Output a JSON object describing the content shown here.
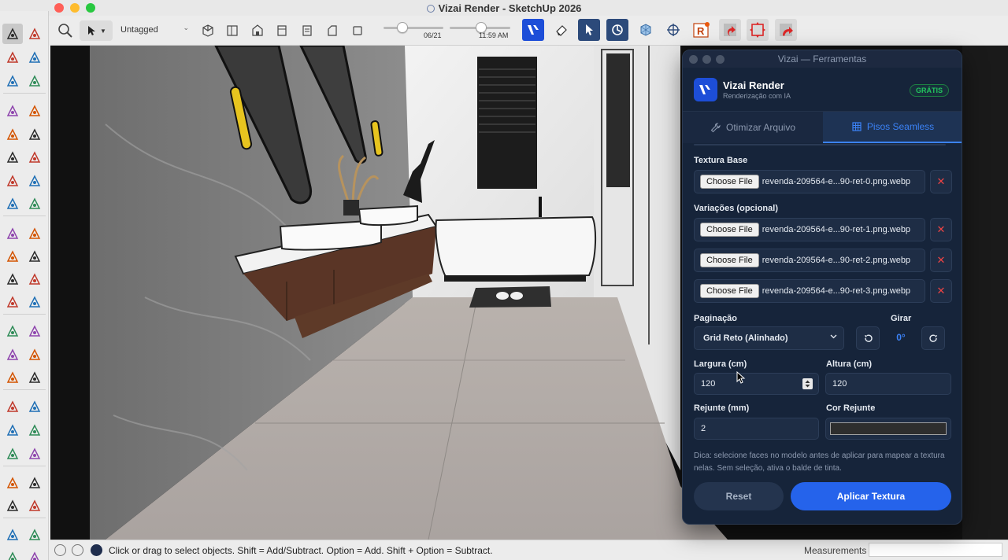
{
  "window": {
    "title": "Vizai Render - SketchUp 2026"
  },
  "toolbar": {
    "tag_value": "Untagged",
    "date_label": "06/21",
    "time_label": "11:59 AM",
    "date_fraction": 0.32,
    "time_fraction": 0.52,
    "icons": [
      "zoom-icon",
      "select-icon",
      "tag-icon",
      "view-iso-icon",
      "view-top-icon",
      "view-front-icon",
      "view-right-icon",
      "view-back-icon",
      "view-left-icon",
      "view-bottom-icon",
      "vizai-logo-icon",
      "eraser-icon",
      "ext-blue-1-icon",
      "ext-blue-2-icon",
      "ext-cube-icon",
      "ext-target-icon",
      "ext-render-icon",
      "ext-red-1-icon",
      "ext-red-2-icon",
      "ext-red-3-icon"
    ]
  },
  "status": {
    "hint": "Click or drag to select objects. Shift = Add/Subtract. Option = Add. Shift + Option = Subtract.",
    "measurements_label": "Measurements"
  },
  "panel": {
    "window_title": "Vizai — Ferramentas",
    "brand": "Vizai Render",
    "brand_sub": "Renderização com IA",
    "badge": "GRÁTIS",
    "tabs": [
      {
        "label": "Otimizar Arquivo",
        "icon": "wrench-icon",
        "active": false
      },
      {
        "label": "Pisos Seamless",
        "icon": "grid-icon",
        "active": true
      }
    ],
    "texture_base_label": "Textura Base",
    "variations_label": "Variações (opcional)",
    "choose_file": "Choose File",
    "files": [
      "revenda-209564-e...90-ret-0.png.webp",
      "revenda-209564-e...90-ret-1.png.webp",
      "revenda-209564-e...90-ret-2.png.webp",
      "revenda-209564-e...90-ret-3.png.webp"
    ],
    "pagination_label": "Paginação",
    "pagination_value": "Grid Reto (Alinhado)",
    "rotate_label": "Girar",
    "rotate_value": "0°",
    "width_label": "Largura (cm)",
    "width_value": "120",
    "height_label": "Altura (cm)",
    "height_value": "120",
    "grout_label": "Rejunte (mm)",
    "grout_value": "2",
    "grout_color_label": "Cor Rejunte",
    "grout_color": "#2e2e2e",
    "tip": "Dica: selecione faces no modelo antes de aplicar para mapear a textura nelas. Sem seleção, ativa o balde de tinta.",
    "reset_label": "Reset",
    "apply_label": "Aplicar Textura"
  },
  "colors": {
    "accent": "#2563eb",
    "accent_text": "#3b82f6",
    "panel_bg": "#16243a",
    "badge_green": "#22c55e",
    "delete_red": "#ef4444"
  }
}
